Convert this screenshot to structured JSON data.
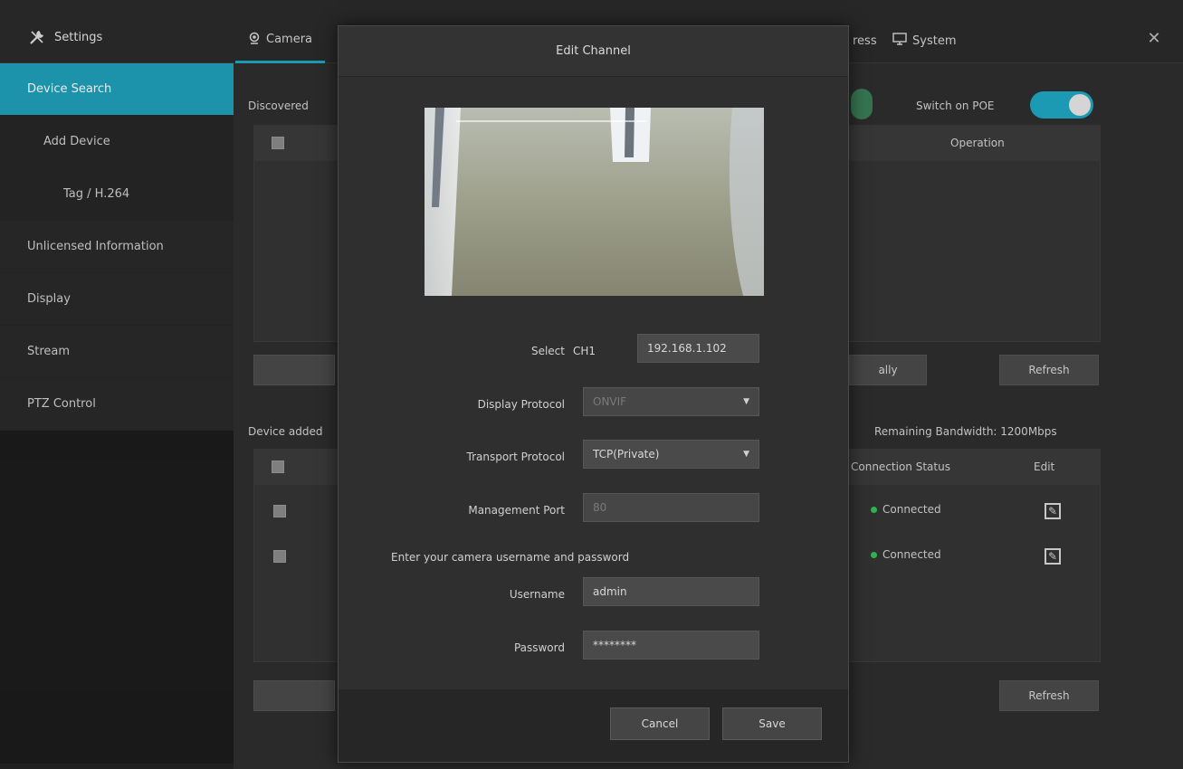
{
  "header": {
    "brand_label": "Settings",
    "tabs": [
      {
        "label": "Camera",
        "icon": "camera-icon"
      },
      {
        "label": "System",
        "icon": "monitor-icon"
      }
    ],
    "partial_tab_fragment": "ress",
    "close_icon": "close-icon"
  },
  "sidebar": {
    "items": [
      {
        "label": "Device Search"
      },
      {
        "label": "Add Device"
      },
      {
        "label": "Tag / H.264"
      },
      {
        "label": "Unlicensed Information"
      },
      {
        "label": "Display"
      },
      {
        "label": "Stream"
      },
      {
        "label": "PTZ Control"
      }
    ]
  },
  "main": {
    "upper": {
      "section_label": "Discovered",
      "switch_label": "Switch on POE",
      "header_col": "Operation",
      "buttons": {
        "add_partial": "ally",
        "refresh": "Refresh"
      }
    },
    "lower": {
      "section_label": "Device added",
      "bandwidth_label": "Remaining Bandwidth: 1200Mbps",
      "columns": {
        "connection": "Connection Status",
        "edit": "Edit"
      },
      "rows": [
        {
          "status": "Connected"
        },
        {
          "status": "Connected"
        }
      ],
      "buttons": {
        "refresh": "Refresh"
      }
    }
  },
  "modal": {
    "title": "Edit Channel",
    "fields": {
      "device_label": "Select",
      "device_channel": "CH1",
      "device_ip": "192.168.1.102",
      "protocol_label": "Display Protocol",
      "protocol_value": "ONVIF",
      "transport_label": "Transport Protocol",
      "transport_value": "TCP(Private)",
      "port_label": "Management Port",
      "port_value": "80",
      "hint": "Enter your camera username and password",
      "username_label": "Username",
      "username_value": "admin",
      "password_label": "Password",
      "password_value": "********"
    },
    "buttons": {
      "cancel": "Cancel",
      "save": "Save"
    }
  }
}
